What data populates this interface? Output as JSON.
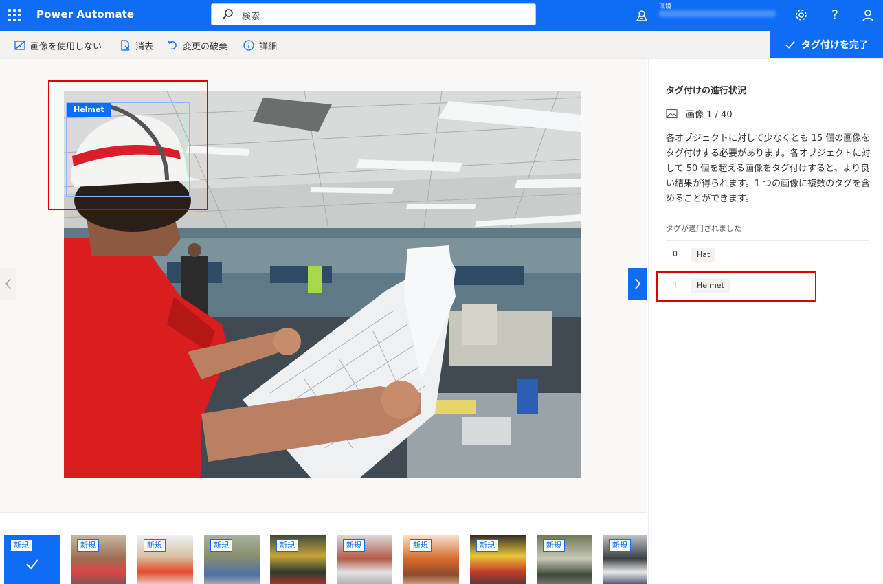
{
  "header": {
    "app_name": "Power Automate",
    "search_placeholder": "検索",
    "environment_label": "環境",
    "icons": [
      "waffle-icon",
      "search-icon",
      "environment-icon",
      "settings-icon",
      "help-icon",
      "account-icon"
    ],
    "accent_color": "#0f6cf5"
  },
  "toolbar": {
    "no_image_label": "画像を使用しない",
    "clear_label": "消去",
    "discard_label": "変更の破棄",
    "details_label": "詳細",
    "done_label": "タグ付けを完了"
  },
  "canvas": {
    "region_tag": "Helmet",
    "highlight_color": "#e00000"
  },
  "thumbnails": {
    "new_label": "新規",
    "items": [
      {
        "selected": true
      },
      {
        "selected": false
      },
      {
        "selected": false
      },
      {
        "selected": false
      },
      {
        "selected": false
      },
      {
        "selected": false
      },
      {
        "selected": false
      },
      {
        "selected": false
      },
      {
        "selected": false
      },
      {
        "selected": false
      }
    ]
  },
  "panel": {
    "title": "タグ付けの進行状況",
    "image_counter": "画像 1 / 40",
    "description": "各オブジェクトに対して少なくとも 15 個の画像をタグ付けする必要があります。各オブジェクトに対して 50 個を超える画像をタグ付けすると、より良い結果が得られます。1 つの画像に複数のタグを含めることができます。",
    "applied_heading": "タグが適用されました",
    "tags": [
      {
        "count": "0",
        "name": "Hat"
      },
      {
        "count": "1",
        "name": "Helmet"
      }
    ]
  }
}
